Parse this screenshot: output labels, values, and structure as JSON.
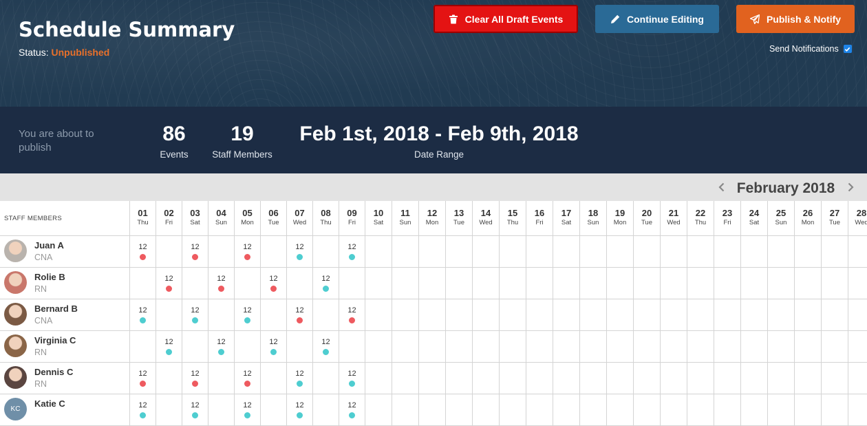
{
  "header": {
    "title": "Schedule Summary",
    "status_label": "Status:",
    "status_value": "Unpublished",
    "buttons": {
      "clear": "Clear All Draft Events",
      "continue": "Continue Editing",
      "publish": "Publish & Notify"
    },
    "send_notifications_label": "Send Notifications",
    "send_notifications_checked": true
  },
  "summary": {
    "intro": "You are about to publish",
    "events_count": "86",
    "events_label": "Events",
    "staff_count": "19",
    "staff_label": "Staff Members",
    "date_range": "Feb 1st, 2018 - Feb 9th, 2018",
    "date_range_label": "Date Range"
  },
  "calendar": {
    "month_label": "February 2018",
    "staff_column_header": "STAFF MEMBERS",
    "days": [
      {
        "d": "01",
        "w": "Thu"
      },
      {
        "d": "02",
        "w": "Fri"
      },
      {
        "d": "03",
        "w": "Sat"
      },
      {
        "d": "04",
        "w": "Sun"
      },
      {
        "d": "05",
        "w": "Mon"
      },
      {
        "d": "06",
        "w": "Tue"
      },
      {
        "d": "07",
        "w": "Wed"
      },
      {
        "d": "08",
        "w": "Thu"
      },
      {
        "d": "09",
        "w": "Fri"
      },
      {
        "d": "10",
        "w": "Sat"
      },
      {
        "d": "11",
        "w": "Sun"
      },
      {
        "d": "12",
        "w": "Mon"
      },
      {
        "d": "13",
        "w": "Tue"
      },
      {
        "d": "14",
        "w": "Wed"
      },
      {
        "d": "15",
        "w": "Thu"
      },
      {
        "d": "16",
        "w": "Fri"
      },
      {
        "d": "17",
        "w": "Sat"
      },
      {
        "d": "18",
        "w": "Sun"
      },
      {
        "d": "19",
        "w": "Mon"
      },
      {
        "d": "20",
        "w": "Tue"
      },
      {
        "d": "21",
        "w": "Wed"
      },
      {
        "d": "22",
        "w": "Thu"
      },
      {
        "d": "23",
        "w": "Fri"
      },
      {
        "d": "24",
        "w": "Sat"
      },
      {
        "d": "25",
        "w": "Sun"
      },
      {
        "d": "26",
        "w": "Mon"
      },
      {
        "d": "27",
        "w": "Tue"
      },
      {
        "d": "28",
        "w": "Wed"
      }
    ],
    "shift_colors": {
      "red": "#ee5a5f",
      "teal": "#4ecdd0"
    },
    "staff": [
      {
        "name": "Juan A",
        "role": "CNA",
        "avatar": "photo",
        "avatar_color": "#b9b3ad",
        "shifts": {
          "01": [
            "12",
            "red"
          ],
          "03": [
            "12",
            "red"
          ],
          "05": [
            "12",
            "red"
          ],
          "07": [
            "12",
            "teal"
          ],
          "09": [
            "12",
            "teal"
          ]
        }
      },
      {
        "name": "Rolie B",
        "role": "RN",
        "avatar": "photo",
        "avatar_color": "#c9776b",
        "shifts": {
          "02": [
            "12",
            "red"
          ],
          "04": [
            "12",
            "red"
          ],
          "06": [
            "12",
            "red"
          ],
          "08": [
            "12",
            "teal"
          ]
        }
      },
      {
        "name": "Bernard B",
        "role": "CNA",
        "avatar": "photo",
        "avatar_color": "#7b5a44",
        "shifts": {
          "01": [
            "12",
            "teal"
          ],
          "03": [
            "12",
            "teal"
          ],
          "05": [
            "12",
            "teal"
          ],
          "07": [
            "12",
            "red"
          ],
          "09": [
            "12",
            "red"
          ]
        }
      },
      {
        "name": "Virginia C",
        "role": "RN",
        "avatar": "photo",
        "avatar_color": "#8a6547",
        "shifts": {
          "02": [
            "12",
            "teal"
          ],
          "04": [
            "12",
            "teal"
          ],
          "06": [
            "12",
            "teal"
          ],
          "08": [
            "12",
            "teal"
          ]
        }
      },
      {
        "name": "Dennis C",
        "role": "RN",
        "avatar": "photo",
        "avatar_color": "#5a4540",
        "shifts": {
          "01": [
            "12",
            "red"
          ],
          "03": [
            "12",
            "red"
          ],
          "05": [
            "12",
            "red"
          ],
          "07": [
            "12",
            "teal"
          ],
          "09": [
            "12",
            "teal"
          ]
        }
      },
      {
        "name": "Katie C",
        "role": "",
        "avatar": "initials",
        "initials": "KC",
        "avatar_color": "#6f8fa8",
        "shifts": {
          "01": [
            "12",
            "teal"
          ],
          "03": [
            "12",
            "teal"
          ],
          "05": [
            "12",
            "teal"
          ],
          "07": [
            "12",
            "teal"
          ],
          "09": [
            "12",
            "teal"
          ]
        }
      }
    ]
  }
}
